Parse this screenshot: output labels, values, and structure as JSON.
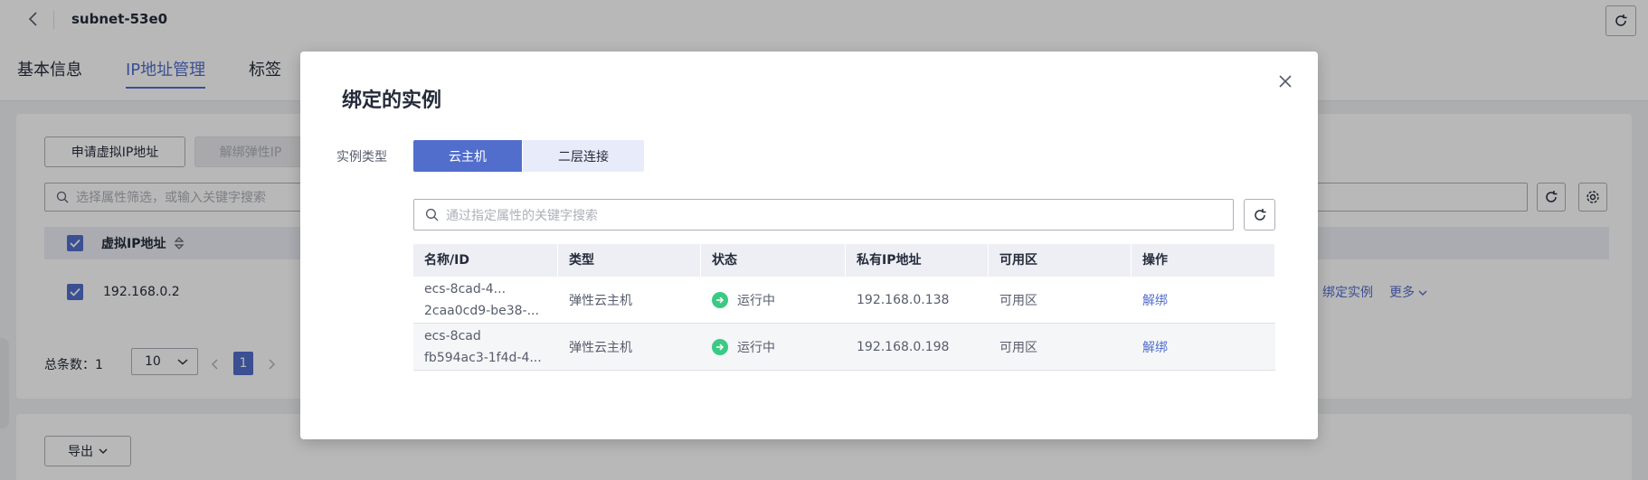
{
  "header": {
    "title": "subnet-53e0"
  },
  "tabs": [
    "基本信息",
    "IP地址管理",
    "标签"
  ],
  "toolbar": {
    "apply_vip": "申请虚拟IP地址",
    "unbind_eip": "解绑弹性IP",
    "search_placeholder": "选择属性筛选，或输入关键字搜索"
  },
  "bg_table": {
    "column_vip": "虚拟IP地址",
    "row_ip": "192.168.0.2",
    "bind_instance": "绑定实例",
    "more": "更多"
  },
  "pager": {
    "total": "总条数：1",
    "size": "10",
    "page": "1"
  },
  "export": "导出",
  "modal": {
    "title": "绑定的实例",
    "type_label": "实例类型",
    "segments": [
      "云主机",
      "二层连接"
    ],
    "search_placeholder": "通过指定属性的关键字搜索",
    "columns": [
      "名称/ID",
      "类型",
      "状态",
      "私有IP地址",
      "可用区",
      "操作"
    ],
    "rows": [
      {
        "name": "ecs-8cad-4...",
        "id": "2caa0cd9-be38-...",
        "type": "弹性云主机",
        "status": "运行中",
        "ip": "192.168.0.138",
        "zone": "可用区",
        "action": "解绑"
      },
      {
        "name": "ecs-8cad",
        "id": "fb594ac3-1f4d-4...",
        "type": "弹性云主机",
        "status": "运行中",
        "ip": "192.168.0.198",
        "zone": "可用区",
        "action": "解绑"
      }
    ]
  },
  "colors": {
    "accent": "#526ecc",
    "status_running": "#3cc984"
  }
}
